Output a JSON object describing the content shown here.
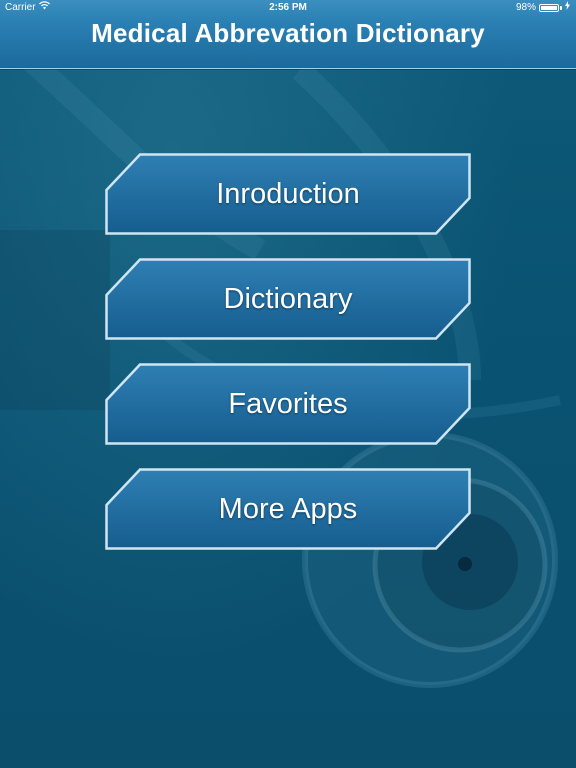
{
  "status_bar": {
    "carrier": "Carrier",
    "time": "2:56 PM",
    "battery_percent": "98%",
    "battery_level": 0.98
  },
  "nav": {
    "title": "Medical Abbrevation Dictionary"
  },
  "menu": {
    "items": [
      {
        "label": "Inroduction"
      },
      {
        "label": "Dictionary"
      },
      {
        "label": "Favorites"
      },
      {
        "label": "More Apps"
      }
    ]
  },
  "colors": {
    "nav_top": "#3a8fc0",
    "nav_bottom": "#1b6a9c",
    "background": "#0b4f6e",
    "button_fill_top": "#2f7fb4",
    "button_fill_bottom": "#155d8e",
    "button_border": "#cfe6f2"
  }
}
